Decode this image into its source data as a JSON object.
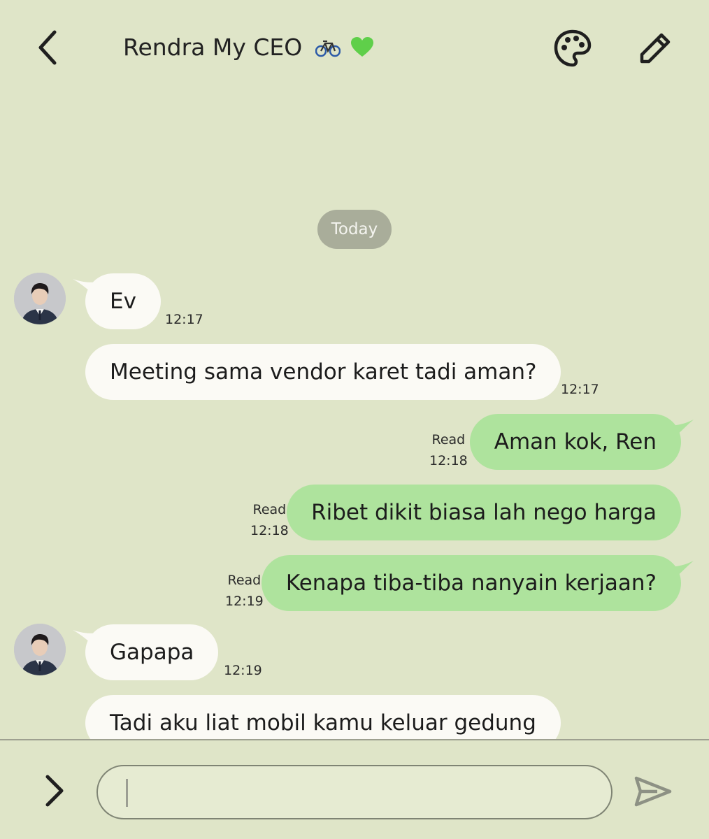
{
  "header": {
    "title": "Rendra My CEO",
    "title_emojis": [
      "bicycle-icon",
      "green-heart-icon"
    ],
    "back_icon": "chevron-left-icon",
    "palette_icon": "palette-icon",
    "edit_icon": "pencil-icon"
  },
  "date_chip": "Today",
  "messages": [
    {
      "side": "in",
      "text": "Ev",
      "time": "12:17"
    },
    {
      "side": "in",
      "text": "Meeting sama vendor karet tadi aman?",
      "time": "12:17"
    },
    {
      "side": "out",
      "text": "Aman kok, Ren",
      "status": "Read",
      "time": "12:18"
    },
    {
      "side": "out",
      "text": "Ribet dikit biasa lah nego harga",
      "status": "Read",
      "time": "12:18"
    },
    {
      "side": "out",
      "text": "Kenapa tiba-tiba nanyain kerjaan?",
      "status": "Read",
      "time": "12:19"
    },
    {
      "side": "in",
      "text": "Gapapa",
      "time": "12:19"
    },
    {
      "side": "in",
      "text": "Tadi aku liat mobil kamu keluar gedung",
      "time": ""
    }
  ],
  "composer": {
    "value": "",
    "placeholder": "",
    "expand_icon": "chevron-right-icon",
    "send_icon": "send-icon"
  },
  "colors": {
    "background": "#dfe5c8",
    "incoming_bubble": "#fbfaf5",
    "outgoing_bubble": "#aee39d",
    "date_chip": "#a9ad9a"
  }
}
